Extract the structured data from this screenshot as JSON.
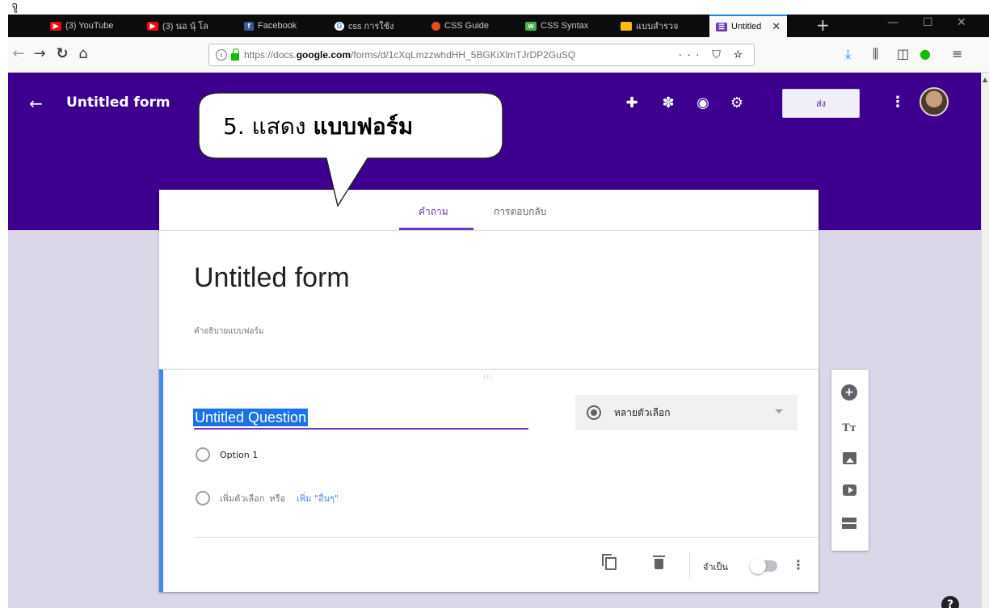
{
  "page": {
    "corner_glyph": "จู"
  },
  "browser": {
    "tabs": [
      {
        "label": "(3) YouTube",
        "icon": "youtube-icon",
        "color": "#ff0000"
      },
      {
        "label": "(3) นอ นุ้ โล",
        "icon": "youtube-icon",
        "color": "#ff0000"
      },
      {
        "label": "Facebook",
        "icon": "facebook-icon",
        "color": "#3b5998"
      },
      {
        "label": "css การใช้ง",
        "icon": "google-icon",
        "color": "#ffffff"
      },
      {
        "label": "CSS Guide",
        "icon": "css-guide-icon",
        "color": "#e34c26"
      },
      {
        "label": "CSS Syntax",
        "icon": "w3schools-icon",
        "color": "#4caf50"
      },
      {
        "label": "แบบสำรวจ",
        "icon": "drive-icon",
        "color": "#fbbc04"
      }
    ],
    "active_tab": {
      "label": "Untitled",
      "icon": "forms-icon",
      "color": "#673ab7"
    },
    "url_prefix": "https://docs.",
    "url_domain": "google.com",
    "url_rest": "/forms/d/1cXqLmzzwhdHH_5BGKiXlmTJrDP2GuSQ",
    "url_actions": "··· ⛉ ☆"
  },
  "app": {
    "title": "Untitled form",
    "send_label": "ส่ง",
    "tabs": {
      "questions": "คำถาม",
      "responses": "การตอบกลับ"
    },
    "form_title": "Untitled form",
    "form_description": "คำอธิบายแบบฟอร์ม",
    "question": {
      "title": "Untitled Question",
      "type_label": "หลายตัวเลือก",
      "option_1": "Option 1",
      "add_option": "เพิ่มตัวเลือก",
      "or": "หรือ",
      "add_other": "เพิ่ม \"อื่นๆ\"",
      "required_label": "จำเป็น",
      "required": false
    }
  },
  "annotation": {
    "prefix": "5. แสดง ",
    "emphasis": "แบบฟอร์ม"
  },
  "colors": {
    "header": "#3d008e",
    "accent": "#673ab7",
    "selection": "#1a73e8",
    "card_border": "#4285f4"
  }
}
